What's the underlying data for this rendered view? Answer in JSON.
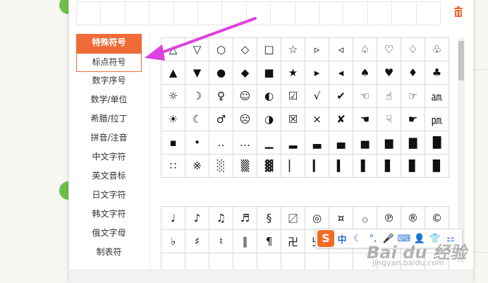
{
  "sidebar": {
    "categories": [
      {
        "label": "特殊符号",
        "state": "active"
      },
      {
        "label": "标点符号",
        "state": "selected"
      },
      {
        "label": "数字序号",
        "state": ""
      },
      {
        "label": "数学/单位",
        "state": ""
      },
      {
        "label": "希腊/拉丁",
        "state": ""
      },
      {
        "label": "拼音/注音",
        "state": ""
      },
      {
        "label": "中文字符",
        "state": ""
      },
      {
        "label": "英文音标",
        "state": ""
      },
      {
        "label": "日文字符",
        "state": ""
      },
      {
        "label": "韩文字符",
        "state": ""
      },
      {
        "label": "俄文字母",
        "state": ""
      },
      {
        "label": "制表符",
        "state": ""
      }
    ]
  },
  "symbols_grid_1": [
    [
      "△",
      "▽",
      "○",
      "◇",
      "□",
      "☆",
      "▹",
      "◃",
      "♤",
      "♡",
      "♢",
      "♧"
    ],
    [
      "▲",
      "▼",
      "●",
      "◆",
      "■",
      "★",
      "▸",
      "◂",
      "♠",
      "♥",
      "♦",
      "♣"
    ],
    [
      "☼",
      "☽",
      "♀",
      "☺",
      "◐",
      "☑",
      "√",
      "✔",
      "☜",
      "☝",
      "☞",
      "㏂"
    ],
    [
      "☀",
      "☾",
      "♂",
      "☹",
      "◑",
      "☒",
      "×",
      "✘",
      "☚",
      "☟",
      "☛",
      "㏘"
    ],
    [
      "▪",
      "•",
      "‥",
      "…",
      "▁",
      "▂",
      "▃",
      "▄",
      "▅",
      "▆",
      "▇",
      "█"
    ],
    [
      "∷",
      "※",
      "░",
      "▒",
      "▓",
      "▏",
      "▎",
      "▍",
      "▌",
      "▋",
      "▊",
      "▉"
    ]
  ],
  "symbols_grid_2": [
    [
      "♩",
      "♪",
      "♫",
      "♬",
      "§",
      "〼",
      "◎",
      "¤",
      "۞",
      "℗",
      "®",
      "©"
    ],
    [
      "♭",
      "♯",
      "♮",
      "‖",
      "¶",
      "卍",
      "卐",
      "",
      "",
      "",
      "",
      ""
    ],
    [
      "",
      "",
      "",
      "",
      "",
      "",
      "",
      "",
      "",
      "",
      "",
      ""
    ]
  ],
  "ime_toolbar": {
    "logo": "S",
    "mode": "中",
    "items": [
      "☾",
      "°,",
      "🎤",
      "⌨",
      "👤",
      "👕",
      "⚏"
    ]
  },
  "watermark": {
    "brand": "Bai du 经验",
    "url": "jingyan.baidu.com"
  },
  "colors": {
    "accent": "#f06b38",
    "arrow": "#e040e0",
    "ime_blue": "#2d6fd6"
  }
}
